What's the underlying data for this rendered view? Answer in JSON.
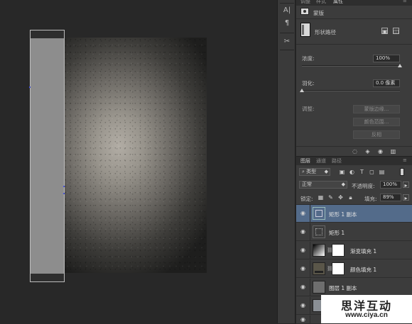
{
  "tool_strip": {
    "icons": [
      "character-icon",
      "paragraph-icon",
      "tools-icon"
    ],
    "glyphs": [
      "A|",
      "¶",
      "✂"
    ]
  },
  "properties": {
    "tabs": [
      "调整",
      "样式",
      "属性"
    ],
    "header_label": "蒙版",
    "section_label": "形状路径",
    "density_label": "浓度:",
    "density_value": "100%",
    "density_fraction": 1.0,
    "feather_label": "羽化:",
    "feather_value": "0.0 像素",
    "feather_fraction": 0.0,
    "adjust_label": "调整:",
    "mask_edge_btn": "蒙版边缘...",
    "color_range_btn": "颜色范围...",
    "invert_btn": "反相"
  },
  "layers": {
    "tabs": [
      "图层",
      "通道",
      "路径"
    ],
    "filter_kind": "类型",
    "blend_mode": "正常",
    "opacity_label": "不透明度:",
    "opacity_value": "100%",
    "lock_label": "锁定:",
    "fill_label": "填充:",
    "fill_value": "89%",
    "rows": [
      {
        "name": "矩形 1 副本",
        "selected": true
      },
      {
        "name": "矩形 1",
        "selected": false
      },
      {
        "name": "渐变填充 1",
        "selected": false
      },
      {
        "name": "颜色填充 1",
        "selected": false
      },
      {
        "name": "图层 1 副本",
        "selected": false
      }
    ]
  },
  "watermark": {
    "title": "思洋互动",
    "url": "www.ciya.cn"
  },
  "colors": {
    "canvas_bg": "#282828",
    "panel_bg": "#3c3c3c",
    "selected_layer": "#536b8a",
    "rect_fill": "#8d8d8d"
  }
}
